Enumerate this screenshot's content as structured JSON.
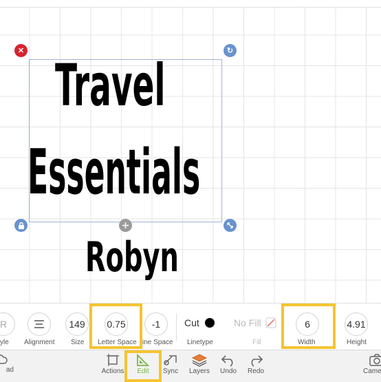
{
  "canvas": {
    "text_lines": [
      "Travel",
      "Essentials",
      "Robyn"
    ]
  },
  "handles": {
    "delete": "✕",
    "rotate": "↻",
    "lock": "lock-icon",
    "size": "resize-icon",
    "center": "move-icon"
  },
  "params": {
    "style": {
      "value": "R",
      "label": "yle"
    },
    "alignment": {
      "label": "Alignment"
    },
    "size": {
      "value": "149",
      "label": "Size"
    },
    "letter_space": {
      "value": "0.75",
      "label": "Letter Space"
    },
    "line_space": {
      "value": "-1",
      "label": "ine Space"
    },
    "linetype": {
      "value": "Cut",
      "label": "Linetype"
    },
    "fill": {
      "value": "No Fill",
      "label": "Fill"
    },
    "width": {
      "value": "6",
      "label": "Width"
    },
    "height": {
      "value": "4.91",
      "label": "Height"
    }
  },
  "toolbar": {
    "upload": "ad",
    "actions": "Actions",
    "edit": "Edit",
    "sync": "Sync",
    "layers": "Layers",
    "undo": "Undo",
    "redo": "Redo",
    "camera": "Came"
  },
  "colors": {
    "accent_highlight": "#f4c431",
    "edit_active": "#7ab648",
    "delete_handle": "#d6232f",
    "handle_blue": "#6a92cf"
  }
}
